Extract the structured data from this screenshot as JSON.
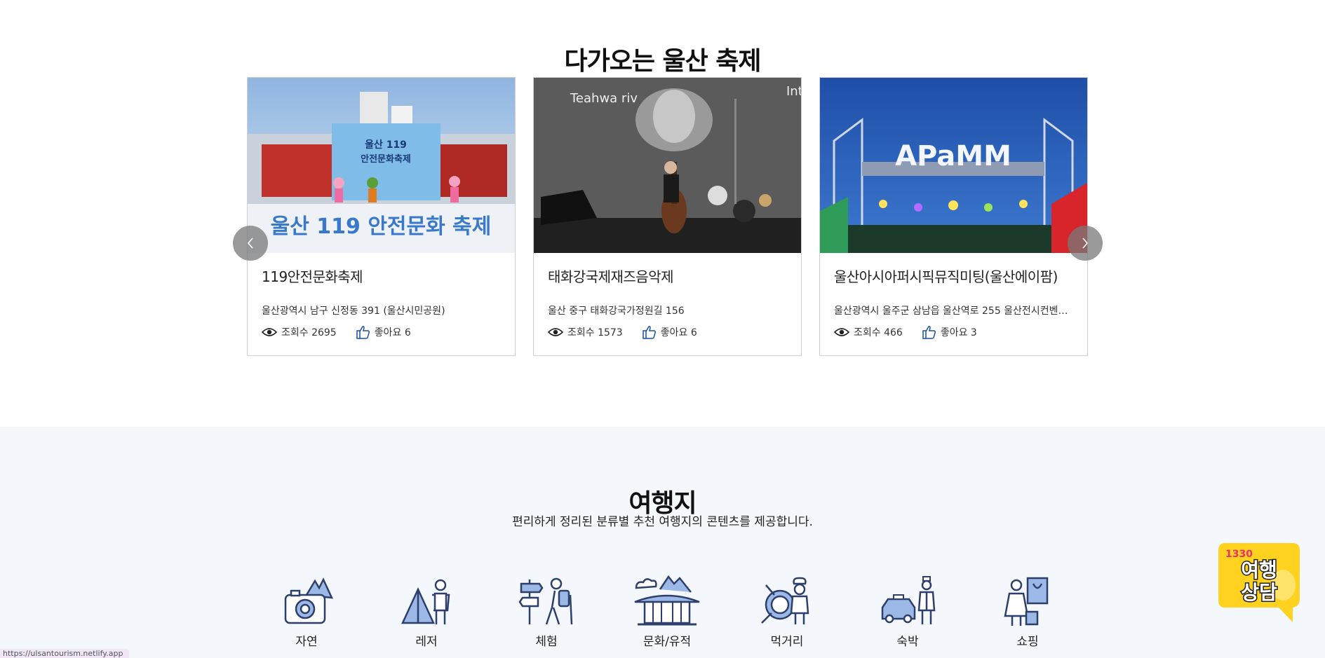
{
  "festival": {
    "title": "다가오는 울산 축제",
    "cards": [
      {
        "name": "119안전문화축제",
        "address": "울산광역시 남구 신정동 391 (울산시민공원)",
        "views_label": "조회수 2695",
        "likes_label": "좋아요 6",
        "photo_banner": "울산 119 안전문화축제"
      },
      {
        "name": "태화강국제재즈음악제",
        "address": "울산 중구 태화강국가정원길 156",
        "views_label": "조회수 1573",
        "likes_label": "좋아요 6",
        "photo_banner": "Teahwa riv"
      },
      {
        "name": "울산아시아퍼시픽뮤직미팅(울산에이팜)",
        "address": "울산광역시 울주군 삼남읍 울산역로 255 울산전시컨벤션...",
        "views_label": "조회수 466",
        "likes_label": "좋아요 3",
        "photo_banner": "APaMM"
      }
    ]
  },
  "travel": {
    "title": "여행지",
    "subtitle": "편리하게 정리된 분류별 추천 여행지의 콘텐츠를 제공합니다.",
    "categories": [
      {
        "label": "자연",
        "icon": "camera-mountain-icon"
      },
      {
        "label": "레저",
        "icon": "tent-hiker-icon"
      },
      {
        "label": "체험",
        "icon": "signpost-hiker-icon"
      },
      {
        "label": "문화/유적",
        "icon": "palace-icon"
      },
      {
        "label": "먹거리",
        "icon": "chef-plate-icon"
      },
      {
        "label": "숙박",
        "icon": "taxi-bellhop-icon"
      },
      {
        "label": "쇼핑",
        "icon": "shopper-icon"
      }
    ]
  },
  "chat_badge": {
    "number": "1330",
    "line1": "여행",
    "line2": "상담"
  },
  "status_url": "https://ulsantourism.netlify.app",
  "colors": {
    "icon_stroke": "#2e3f6b",
    "icon_fill": "#9bb8e6",
    "travel_bg": "#f4f8fc",
    "badge_yellow": "#ffd21f",
    "like_blue": "#1a4fa0"
  }
}
